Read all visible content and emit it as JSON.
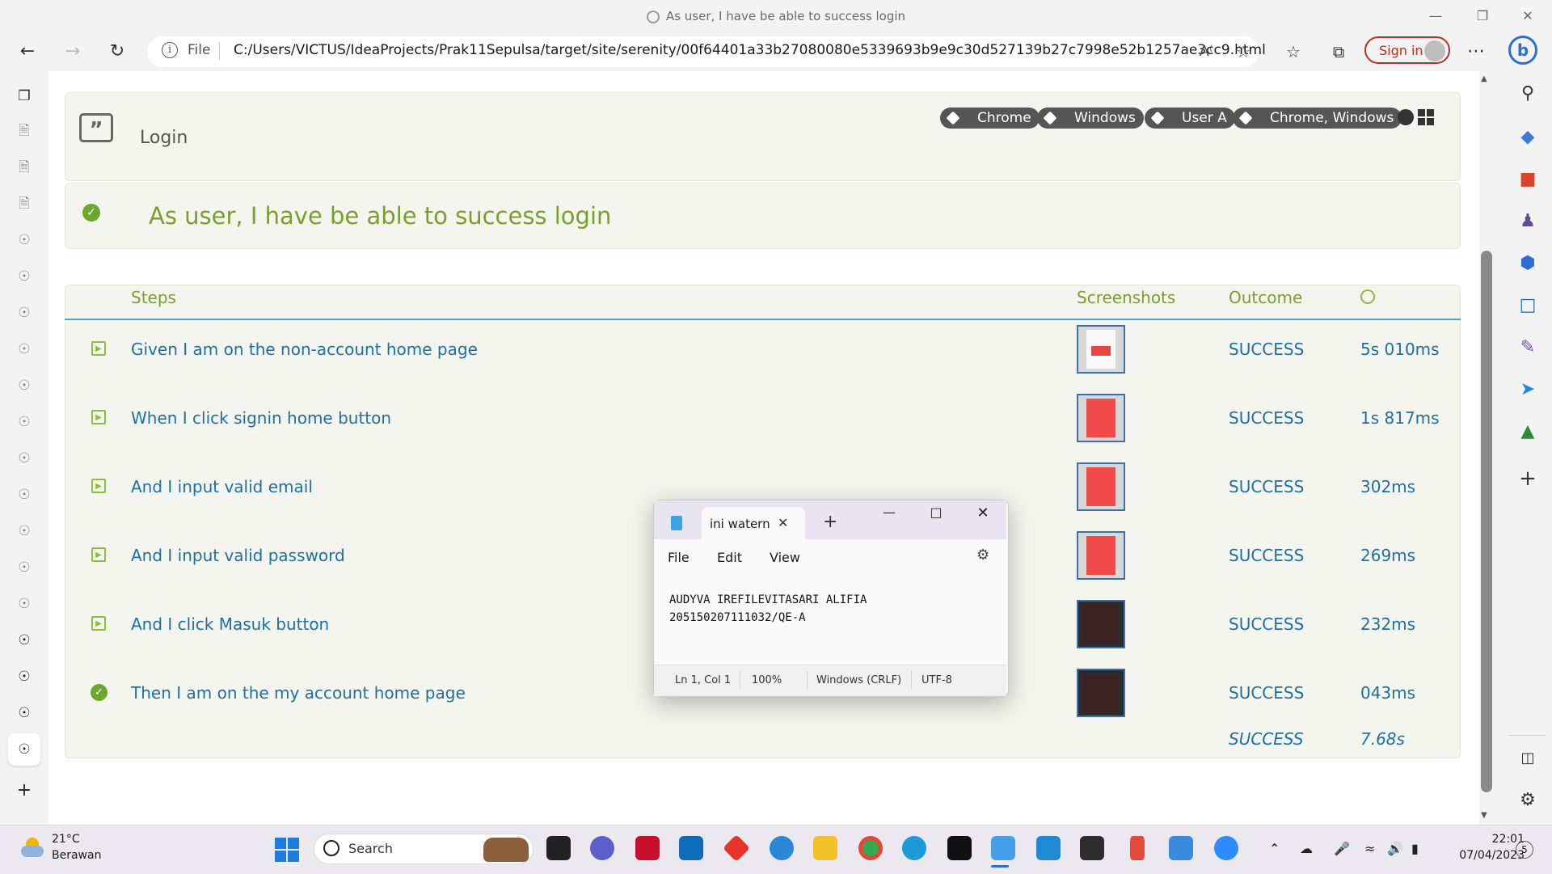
{
  "window": {
    "title": "As user, I have be able to success login"
  },
  "toolbar": {
    "file_label": "File",
    "url": "C:/Users/VICTUS/IdeaProjects/Prak11Sepulsa/target/site/serenity/00f64401a33b27080080e5339693b9e9c30d527139b27c7998e52b1257ae3cc9.html",
    "signin_label": "Sign in"
  },
  "report": {
    "feature_label": "Login",
    "tags": [
      "Chrome",
      "Windows",
      "User A",
      "Chrome, Windows"
    ],
    "scenario_title": "As user, I have be able to success login",
    "columns": {
      "steps": "Steps",
      "screenshots": "Screenshots",
      "outcome": "Outcome",
      "duration_icon": "stopwatch-icon"
    },
    "steps": [
      {
        "text": "Given I am on the non-account home page",
        "outcome": "SUCCESS",
        "duration": "5s 010ms"
      },
      {
        "text": "When I click signin home button",
        "outcome": "SUCCESS",
        "duration": "1s 817ms"
      },
      {
        "text": "And I input valid email",
        "outcome": "SUCCESS",
        "duration": "302ms"
      },
      {
        "text": "And I input valid password",
        "outcome": "SUCCESS",
        "duration": "269ms"
      },
      {
        "text": "And I click Masuk button",
        "outcome": "SUCCESS",
        "duration": "232ms"
      },
      {
        "text": "Then I am on the my account home page",
        "outcome": "SUCCESS",
        "duration": "043ms"
      }
    ],
    "total": {
      "outcome": "SUCCESS",
      "duration": "7.68s"
    },
    "colors": {
      "success_green": "#7a9f2c",
      "link_blue": "#1f6fa3"
    }
  },
  "notepad": {
    "tab_title": "ini watern",
    "menu": [
      "File",
      "Edit",
      "View"
    ],
    "content_line1": "AUDYVA IREFILEVITASARI ALIFIA",
    "content_line2": "205150207111032/QE-A",
    "status": {
      "position": "Ln 1, Col 1",
      "zoom": "100%",
      "line_endings": "Windows (CRLF)",
      "encoding": "UTF-8"
    }
  },
  "taskbar": {
    "weather_temp": "21°C",
    "weather_desc": "Berawan",
    "search_label": "Search",
    "time": "22:01",
    "date": "07/04/2023",
    "notification_count": "5"
  }
}
